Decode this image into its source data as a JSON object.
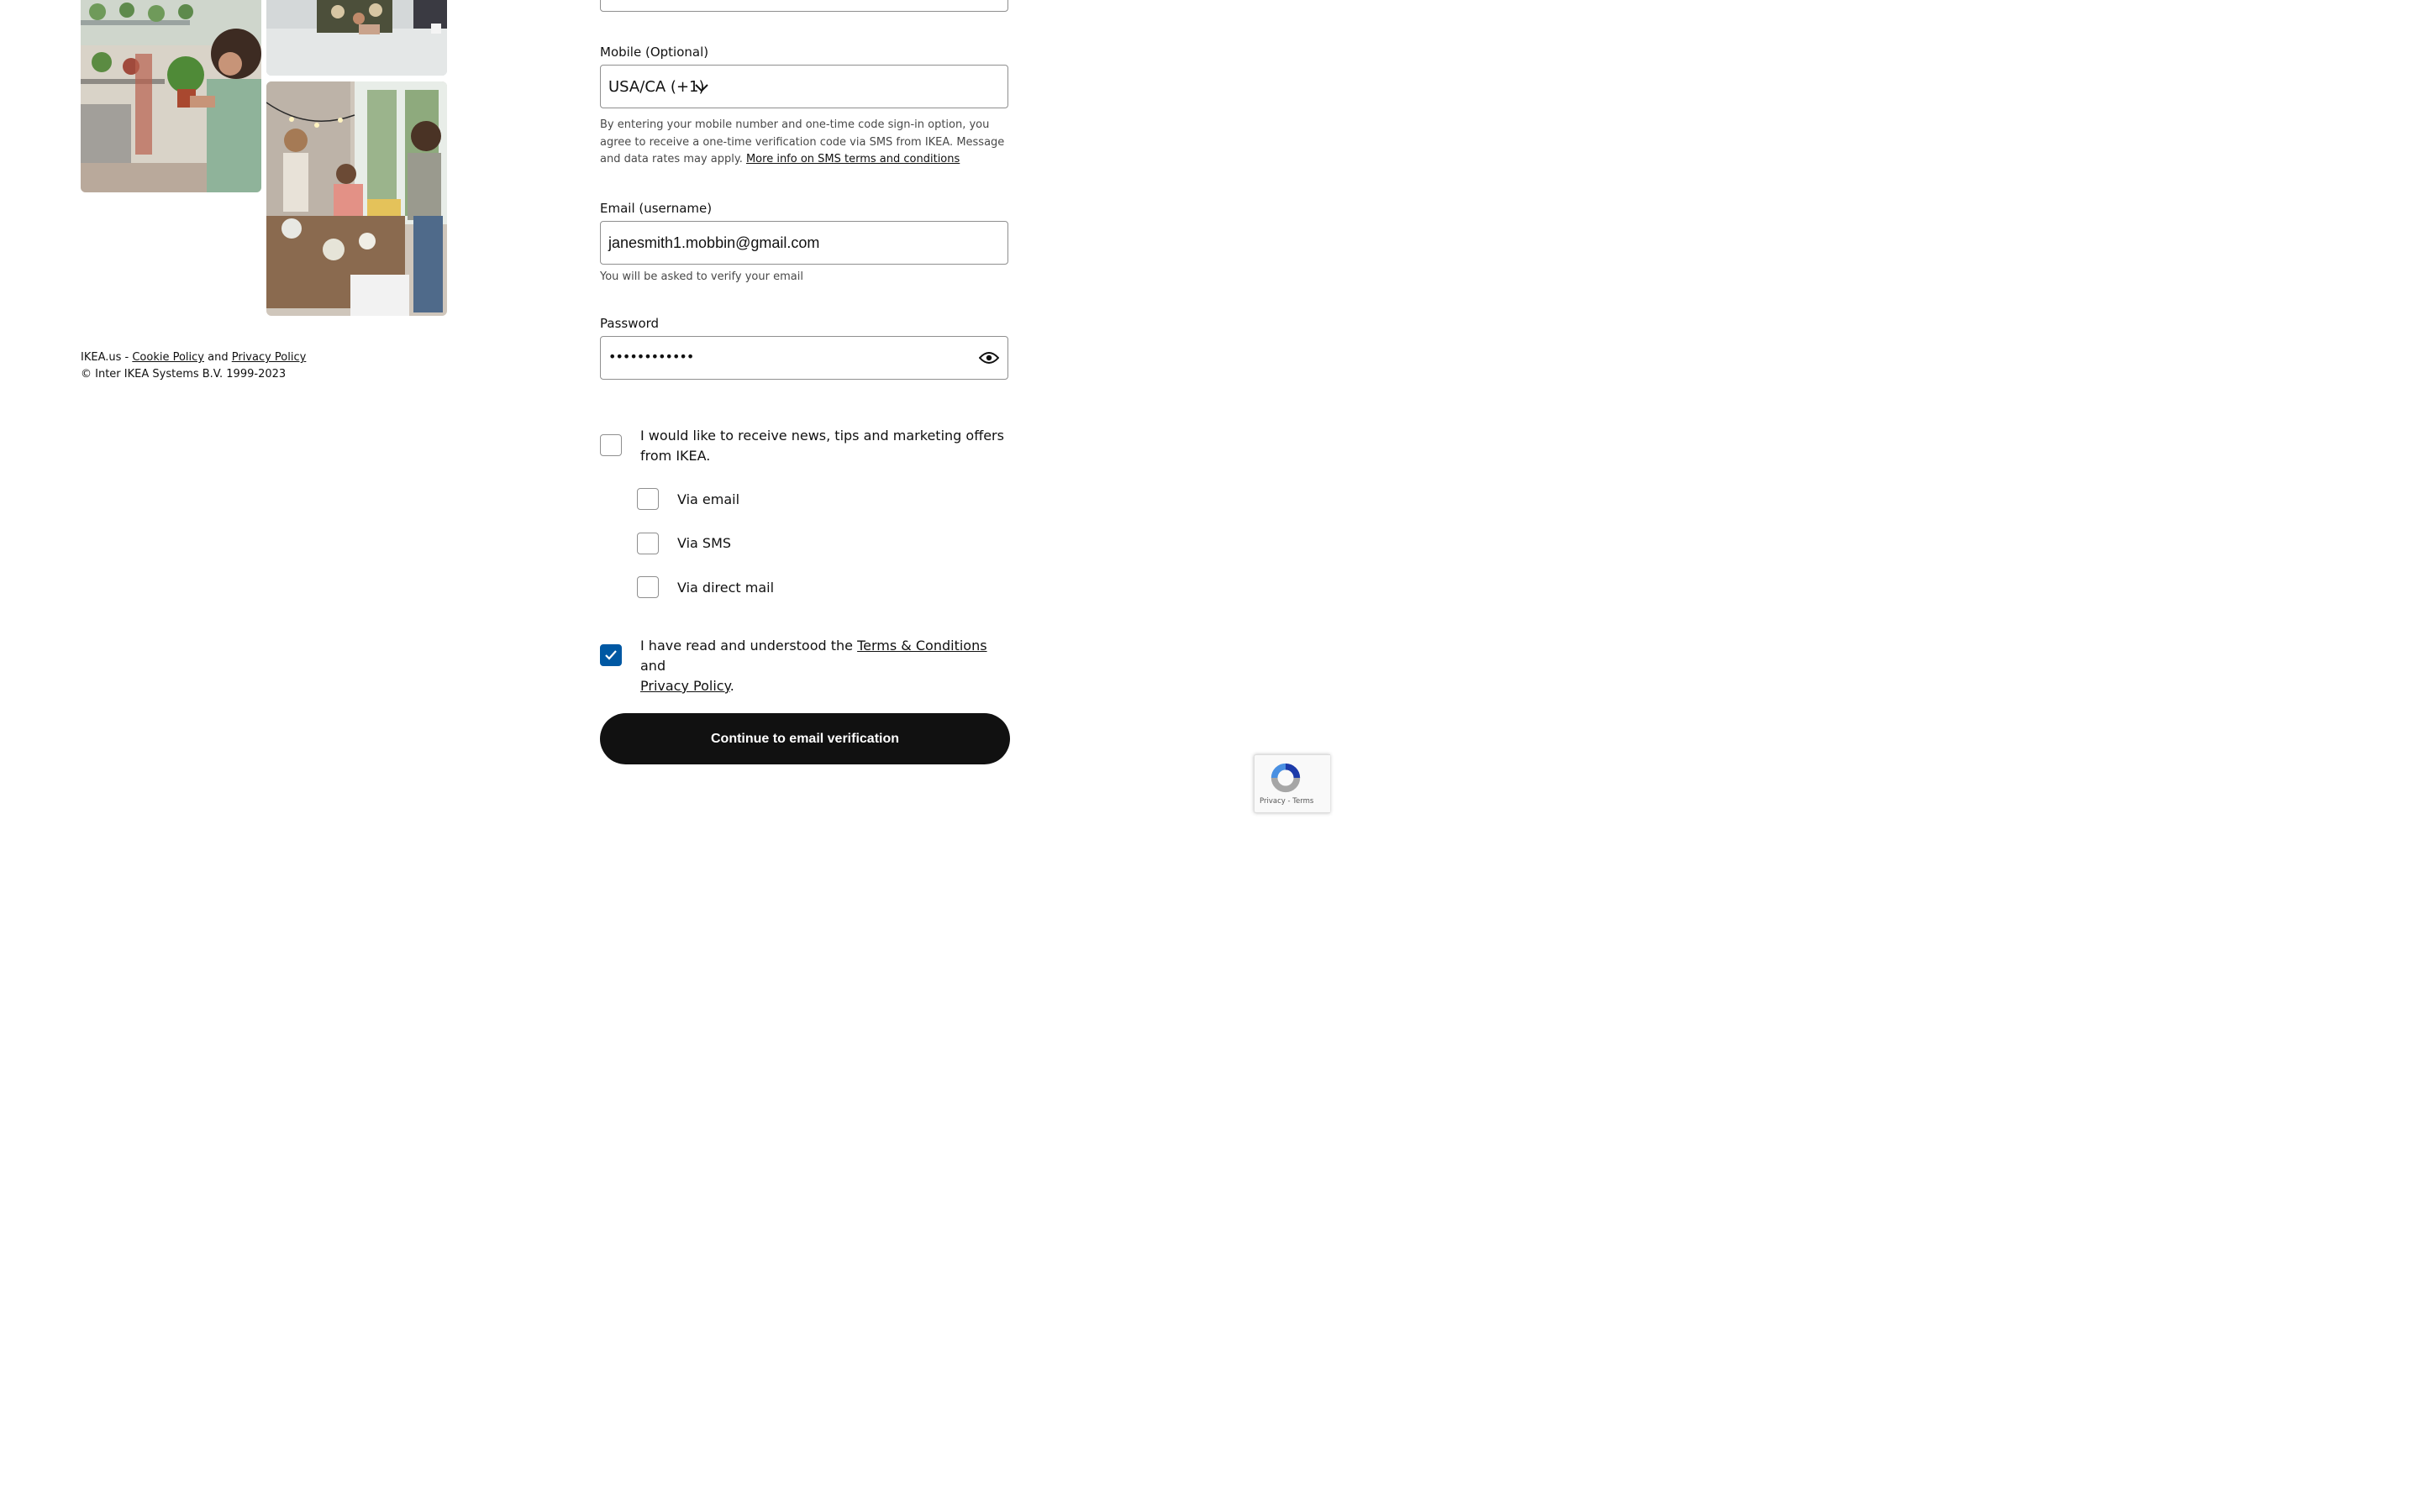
{
  "footer": {
    "site": "IKEA.us - ",
    "cookie_link": "Cookie Policy",
    "and": " and ",
    "privacy_link": "Privacy Policy",
    "copyright": "© Inter IKEA Systems B.V. 1999-2023"
  },
  "form": {
    "mobile": {
      "label": "Mobile (Optional)",
      "country_value": "USA/CA (+1)",
      "helper_text": "By entering your mobile number and one-time code sign-in option, you agree to receive a one-time verification code via SMS from IKEA. Message and data rates may apply. ",
      "helper_link": "More info on SMS terms and conditions"
    },
    "email": {
      "label": "Email (username)",
      "value": "janesmith1.mobbin@gmail.com",
      "helper": "You will be asked to verify your email"
    },
    "password": {
      "label": "Password",
      "value": "••••••••••••"
    },
    "marketing": {
      "label": "I would like to receive news, tips and marketing offers from IKEA.",
      "options": [
        {
          "label": "Via email",
          "checked": false
        },
        {
          "label": "Via SMS",
          "checked": false
        },
        {
          "label": "Via direct mail",
          "checked": false
        }
      ]
    },
    "terms": {
      "prefix": "I have read and understood the ",
      "terms_link": "Terms & Conditions",
      "middle": " and",
      "privacy_link": "Privacy Policy",
      "suffix": ".",
      "checked": true
    },
    "submit_label": "Continue to email verification"
  },
  "recaptcha": {
    "privacy": "Privacy",
    "sep": " - ",
    "terms": "Terms"
  },
  "colors": {
    "accent": "#0058a3",
    "button": "#111111"
  }
}
